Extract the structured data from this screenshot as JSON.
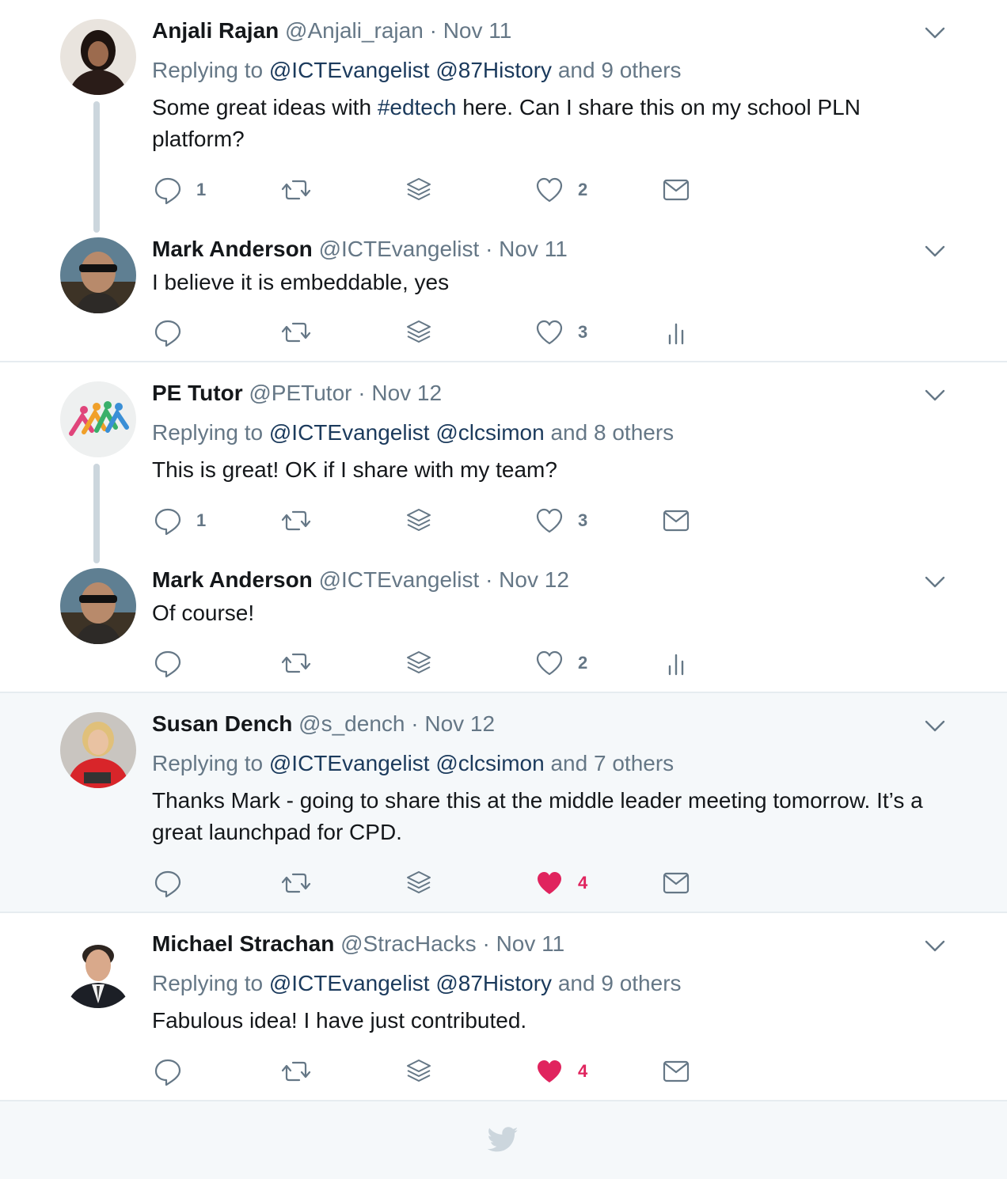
{
  "colors": {
    "accent_link": "#1b3a5c",
    "muted": "#657786",
    "like_active": "#e0245e",
    "divider": "#e6ecf0",
    "highlight_bg": "#f5f8fa"
  },
  "tweets": [
    {
      "name": "Anjali Rajan",
      "handle": "@Anjali_rajan",
      "dot": "·",
      "date": "Nov 11",
      "reply_prefix": "Replying to",
      "reply_handles": "@ICTEvangelist @87History",
      "reply_and": "and",
      "reply_others": "9 others",
      "text_before": "Some great ideas with ",
      "hashtag": "#edtech",
      "text_after": " here. Can I share this on my school PLN platform?",
      "reply_count": "1",
      "like_count": "2",
      "avatar_icon": "avatar-photo-anjali",
      "last_icon": "envelope-icon"
    },
    {
      "name": "Mark Anderson",
      "handle": "@ICTEvangelist",
      "dot": "·",
      "date": "Nov 11",
      "text": "I believe it is embeddable, yes",
      "reply_count": "",
      "like_count": "3",
      "avatar_icon": "avatar-photo-mark",
      "last_icon": "analytics-icon"
    },
    {
      "name": "PE Tutor",
      "handle": "@PETutor",
      "dot": "·",
      "date": "Nov 12",
      "reply_prefix": "Replying to",
      "reply_handles": "@ICTEvangelist @clcsimon",
      "reply_and": "and",
      "reply_others": "8 others",
      "text": "This is great! OK if I share with my team?",
      "reply_count": "1",
      "like_count": "3",
      "avatar_icon": "avatar-logo-petutor",
      "last_icon": "envelope-icon"
    },
    {
      "name": "Mark Anderson",
      "handle": "@ICTEvangelist",
      "dot": "·",
      "date": "Nov 12",
      "text": "Of course!",
      "reply_count": "",
      "like_count": "2",
      "avatar_icon": "avatar-photo-mark",
      "last_icon": "analytics-icon"
    },
    {
      "name": "Susan Dench",
      "handle": "@s_dench",
      "dot": "·",
      "date": "Nov 12",
      "reply_prefix": "Replying to",
      "reply_handles": "@ICTEvangelist @clcsimon",
      "reply_and": "and",
      "reply_others": "7 others",
      "text": "Thanks Mark - going to share this at the middle leader meeting tomorrow. It’s a great launchpad for CPD.",
      "reply_count": "",
      "like_count": "4",
      "liked": true,
      "avatar_icon": "avatar-photo-susan",
      "last_icon": "envelope-icon"
    },
    {
      "name": "Michael Strachan",
      "handle": "@StracHacks",
      "dot": "·",
      "date": "Nov 11",
      "reply_prefix": "Replying to",
      "reply_handles": "@ICTEvangelist @87History",
      "reply_and": "and",
      "reply_others": "9 others",
      "text": "Fabulous idea! I have just contributed.",
      "reply_count": "",
      "like_count": "4",
      "liked": true,
      "avatar_icon": "avatar-photo-michael",
      "last_icon": "envelope-icon"
    }
  ],
  "footer": {
    "icon": "twitter-bird-icon"
  }
}
